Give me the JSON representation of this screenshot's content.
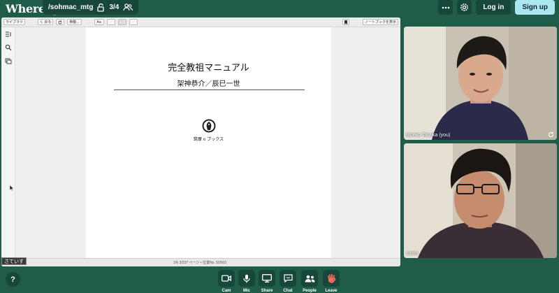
{
  "app": {
    "logo_text": "Whereby"
  },
  "room": {
    "name": "/sohmac_mtg",
    "participant_count": "3/4"
  },
  "header": {
    "menu_icon": "ellipsis-icon",
    "settings_icon": "gear-icon",
    "login_label": "Log in",
    "signup_label": "Sign up"
  },
  "screen_share": {
    "toolbar": {
      "library_label": "ライブラリ",
      "back_label": "く 戻る",
      "reload_icon": "reload-icon",
      "move_label": "移動...",
      "font_label": "Aa",
      "notebook_label": "ノートブックを表示"
    },
    "page": {
      "title": "完全教祖マニュアル",
      "author": "架神恭介／辰巳一世",
      "publisher": "筑摩 e ブックス"
    },
    "status": "1%   3/237 ページ  •  位置No. 5/2601",
    "caption": "さていす"
  },
  "participants": [
    {
      "name": "Moeko Tanaka (you)"
    },
    {
      "name": "soma"
    }
  ],
  "controls": [
    {
      "label": "Cam",
      "icon": "camera-icon"
    },
    {
      "label": "Mic",
      "icon": "microphone-icon"
    },
    {
      "label": "Share",
      "icon": "monitor-icon"
    },
    {
      "label": "Chat",
      "icon": "chat-bubble-icon"
    },
    {
      "label": "People",
      "icon": "people-icon"
    },
    {
      "label": "Leave",
      "icon": "waving-hand-icon"
    }
  ],
  "help": {
    "label": "?"
  },
  "colors": {
    "background": "#1f5c4a",
    "panel": "#16473a",
    "signup": "#a9e8f0",
    "leave_hand": "#f26b5b"
  }
}
